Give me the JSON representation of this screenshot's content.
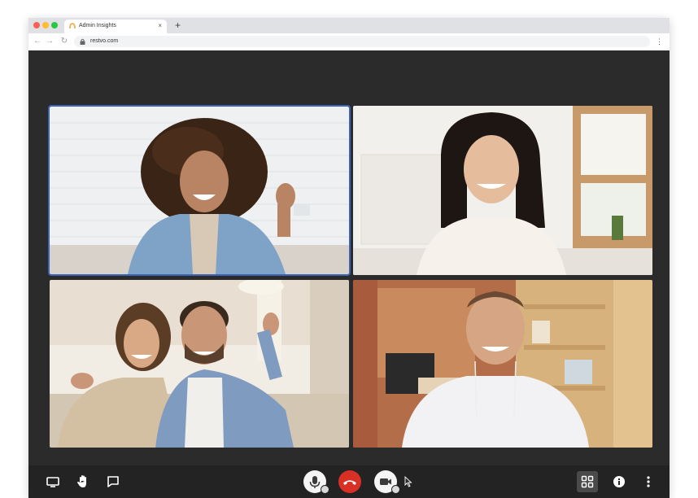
{
  "browser": {
    "tab_title": "Admin Insights",
    "tab_close": "×",
    "new_tab": "+",
    "url": "restvo.com",
    "menu": "⋮",
    "nav": {
      "back": "←",
      "forward": "→",
      "reload": "↻"
    }
  },
  "call": {
    "participants": [
      {
        "id": "participant-1",
        "active": true
      },
      {
        "id": "participant-2",
        "active": false
      },
      {
        "id": "participant-3",
        "active": false
      },
      {
        "id": "participant-4",
        "active": false
      }
    ],
    "controls": {
      "left": [
        "screen-share-icon",
        "raise-hand-icon",
        "chat-icon"
      ],
      "center": [
        "microphone-icon",
        "end-call-icon",
        "camera-icon"
      ],
      "right": [
        "grid-view-icon",
        "info-icon",
        "more-options-icon"
      ]
    },
    "colors": {
      "stage": "#2b2b2b",
      "control_bar": "#232323",
      "end_call": "#d93025",
      "active_outline": "#3b63b8"
    }
  }
}
